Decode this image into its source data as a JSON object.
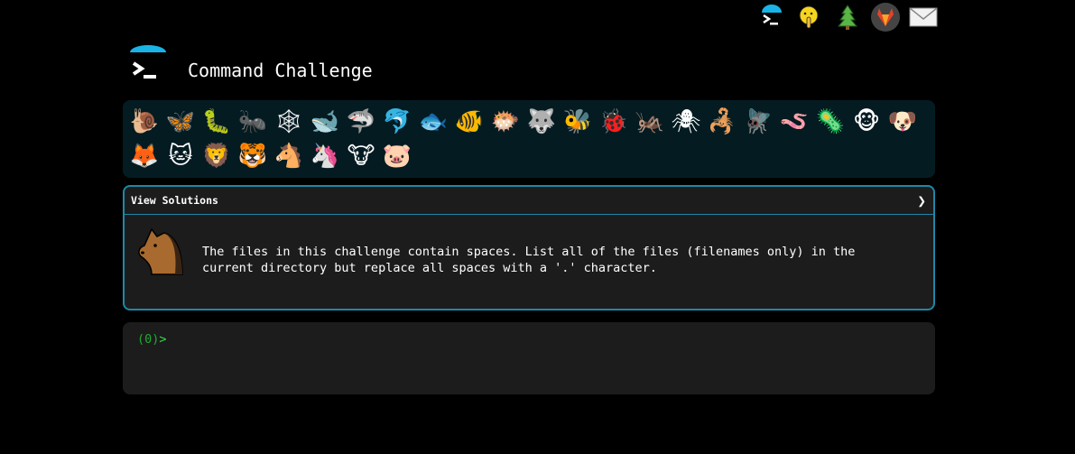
{
  "header": {
    "title": "Command Challenge"
  },
  "top_icons": [
    {
      "name": "terminal-logo-icon"
    },
    {
      "name": "shushing-face-icon",
      "glyph": "🤫"
    },
    {
      "name": "evergreen-tree-icon",
      "glyph": "🌲"
    },
    {
      "name": "gitlab-icon"
    },
    {
      "name": "envelope-icon",
      "glyph": "✉"
    }
  ],
  "animals": [
    {
      "name": "snail-icon",
      "glyph": "🐌"
    },
    {
      "name": "butterfly-icon",
      "glyph": "🦋"
    },
    {
      "name": "caterpillar-icon",
      "glyph": "🐛"
    },
    {
      "name": "ant-icon",
      "glyph": "🐜"
    },
    {
      "name": "spider-web-icon",
      "glyph": "🕸"
    },
    {
      "name": "whale-icon",
      "glyph": "🐋"
    },
    {
      "name": "shark-icon",
      "glyph": "🦈"
    },
    {
      "name": "dolphin-icon",
      "glyph": "🐬"
    },
    {
      "name": "fish-icon",
      "glyph": "🐟"
    },
    {
      "name": "tropical-fish-icon",
      "glyph": "🐠"
    },
    {
      "name": "blowfish-icon",
      "glyph": "🐡"
    },
    {
      "name": "wolf-icon",
      "glyph": "🐺"
    },
    {
      "name": "bee-icon",
      "glyph": "🐝"
    },
    {
      "name": "ladybug-icon",
      "glyph": "🐞"
    },
    {
      "name": "cricket-icon",
      "glyph": "🦗"
    },
    {
      "name": "spider-icon",
      "glyph": "🕷"
    },
    {
      "name": "scorpion-icon",
      "glyph": "🦂"
    },
    {
      "name": "fly-icon",
      "glyph": "🪰"
    },
    {
      "name": "worm-icon",
      "glyph": "🪱"
    },
    {
      "name": "microbe-icon",
      "glyph": "🦠"
    },
    {
      "name": "monkey-face-icon",
      "glyph": "🐵"
    },
    {
      "name": "dog-face-icon",
      "glyph": "🐶"
    },
    {
      "name": "fox-icon",
      "glyph": "🦊"
    },
    {
      "name": "cat-face-icon",
      "glyph": "🐱"
    },
    {
      "name": "lion-icon",
      "glyph": "🦁"
    },
    {
      "name": "tiger-face-icon",
      "glyph": "🐯"
    },
    {
      "name": "horse-face-icon",
      "glyph": "🐴"
    },
    {
      "name": "unicorn-icon",
      "glyph": "🦄"
    },
    {
      "name": "cow-face-icon",
      "glyph": "🐮"
    },
    {
      "name": "pig-face-icon",
      "glyph": "🐷"
    }
  ],
  "challenge": {
    "view_solutions_label": "View Solutions",
    "chevron": "❯",
    "animal_icon": "horse-face-icon",
    "description": "The files in this challenge contain spaces. List all of the files (filenames only) in the\ncurrent directory but replace all spaces with a '.' character."
  },
  "terminal": {
    "prompt_code": "(0)",
    "prompt_symbol": ">"
  },
  "colors": {
    "background": "#000000",
    "animal_bar": "#041b22",
    "panel_border": "#1e88a8",
    "panel_bg": "#1c1c1c",
    "prompt_green": "#33dd44",
    "logo_cyan": "#1ab3e6"
  }
}
